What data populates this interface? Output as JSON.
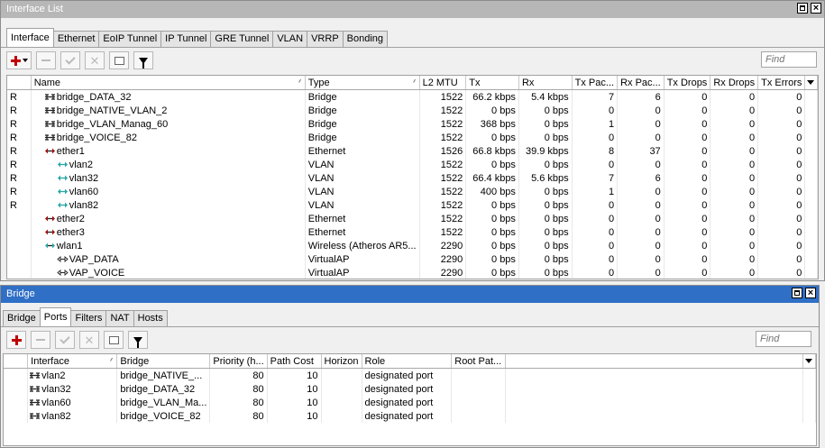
{
  "interface_window": {
    "title": "Interface List",
    "tabs": [
      "Interface",
      "Ethernet",
      "EoIP Tunnel",
      "IP Tunnel",
      "GRE Tunnel",
      "VLAN",
      "VRRP",
      "Bonding"
    ],
    "find_placeholder": "Find",
    "columns": [
      "",
      "Name",
      "Type",
      "L2 MTU",
      "Tx",
      "Rx",
      "Tx Pac...",
      "Rx Pac...",
      "Tx Drops",
      "Rx Drops",
      "Tx Errors"
    ],
    "rows": [
      {
        "flag": "R",
        "icon": "bridge-icon",
        "indent": 1,
        "name": "bridge_DATA_32",
        "type": "Bridge",
        "l2mtu": "1522",
        "tx": "66.2 kbps",
        "rx": "5.4 kbps",
        "txp": "7",
        "rxp": "6",
        "txd": "0",
        "rxd": "0",
        "txe": "0"
      },
      {
        "flag": "R",
        "icon": "bridge-icon",
        "indent": 1,
        "name": "bridge_NATIVE_VLAN_2",
        "type": "Bridge",
        "l2mtu": "1522",
        "tx": "0 bps",
        "rx": "0 bps",
        "txp": "0",
        "rxp": "0",
        "txd": "0",
        "rxd": "0",
        "txe": "0"
      },
      {
        "flag": "R",
        "icon": "bridge-icon",
        "indent": 1,
        "name": "bridge_VLAN_Manag_60",
        "type": "Bridge",
        "l2mtu": "1522",
        "tx": "368 bps",
        "rx": "0 bps",
        "txp": "1",
        "rxp": "0",
        "txd": "0",
        "rxd": "0",
        "txe": "0"
      },
      {
        "flag": "R",
        "icon": "bridge-icon",
        "indent": 1,
        "name": "bridge_VOICE_82",
        "type": "Bridge",
        "l2mtu": "1522",
        "tx": "0 bps",
        "rx": "0 bps",
        "txp": "0",
        "rxp": "0",
        "txd": "0",
        "rxd": "0",
        "txe": "0"
      },
      {
        "flag": "R",
        "icon": "ethernet-icon",
        "indent": 1,
        "name": "ether1",
        "type": "Ethernet",
        "l2mtu": "1526",
        "tx": "66.8 kbps",
        "rx": "39.9 kbps",
        "txp": "8",
        "rxp": "37",
        "txd": "0",
        "rxd": "0",
        "txe": "0"
      },
      {
        "flag": "R",
        "icon": "vlan-icon",
        "indent": 2,
        "name": "vlan2",
        "type": "VLAN",
        "l2mtu": "1522",
        "tx": "0 bps",
        "rx": "0 bps",
        "txp": "0",
        "rxp": "0",
        "txd": "0",
        "rxd": "0",
        "txe": "0"
      },
      {
        "flag": "R",
        "icon": "vlan-icon",
        "indent": 2,
        "name": "vlan32",
        "type": "VLAN",
        "l2mtu": "1522",
        "tx": "66.4 kbps",
        "rx": "5.6 kbps",
        "txp": "7",
        "rxp": "6",
        "txd": "0",
        "rxd": "0",
        "txe": "0"
      },
      {
        "flag": "R",
        "icon": "vlan-icon",
        "indent": 2,
        "name": "vlan60",
        "type": "VLAN",
        "l2mtu": "1522",
        "tx": "400 bps",
        "rx": "0 bps",
        "txp": "1",
        "rxp": "0",
        "txd": "0",
        "rxd": "0",
        "txe": "0"
      },
      {
        "flag": "R",
        "icon": "vlan-icon",
        "indent": 2,
        "name": "vlan82",
        "type": "VLAN",
        "l2mtu": "1522",
        "tx": "0 bps",
        "rx": "0 bps",
        "txp": "0",
        "rxp": "0",
        "txd": "0",
        "rxd": "0",
        "txe": "0"
      },
      {
        "flag": "",
        "icon": "ethernet-icon",
        "indent": 1,
        "name": "ether2",
        "type": "Ethernet",
        "l2mtu": "1522",
        "tx": "0 bps",
        "rx": "0 bps",
        "txp": "0",
        "rxp": "0",
        "txd": "0",
        "rxd": "0",
        "txe": "0"
      },
      {
        "flag": "",
        "icon": "ethernet-icon",
        "indent": 1,
        "name": "ether3",
        "type": "Ethernet",
        "l2mtu": "1522",
        "tx": "0 bps",
        "rx": "0 bps",
        "txp": "0",
        "rxp": "0",
        "txd": "0",
        "rxd": "0",
        "txe": "0"
      },
      {
        "flag": "",
        "icon": "wireless-icon",
        "indent": 1,
        "name": "wlan1",
        "type": "Wireless (Atheros AR5...",
        "l2mtu": "2290",
        "tx": "0 bps",
        "rx": "0 bps",
        "txp": "0",
        "rxp": "0",
        "txd": "0",
        "rxd": "0",
        "txe": "0"
      },
      {
        "flag": "",
        "icon": "virtualap-icon",
        "indent": 2,
        "name": "VAP_DATA",
        "type": "VirtualAP",
        "l2mtu": "2290",
        "tx": "0 bps",
        "rx": "0 bps",
        "txp": "0",
        "rxp": "0",
        "txd": "0",
        "rxd": "0",
        "txe": "0"
      },
      {
        "flag": "",
        "icon": "virtualap-icon",
        "indent": 2,
        "name": "VAP_VOICE",
        "type": "VirtualAP",
        "l2mtu": "2290",
        "tx": "0 bps",
        "rx": "0 bps",
        "txp": "0",
        "rxp": "0",
        "txd": "0",
        "rxd": "0",
        "txe": "0"
      }
    ]
  },
  "bridge_window": {
    "title": "Bridge",
    "tabs": [
      "Bridge",
      "Ports",
      "Filters",
      "NAT",
      "Hosts"
    ],
    "find_placeholder": "Find",
    "columns": [
      "Interface",
      "Bridge",
      "Priority (h...",
      "Path Cost",
      "Horizon",
      "Role",
      "Root Pat..."
    ],
    "rows": [
      {
        "interface": "vlan2",
        "bridge": "bridge_NATIVE_...",
        "priority": "80",
        "path_cost": "10",
        "horizon": "",
        "role": "designated port",
        "root_path": ""
      },
      {
        "interface": "vlan32",
        "bridge": "bridge_DATA_32",
        "priority": "80",
        "path_cost": "10",
        "horizon": "",
        "role": "designated port",
        "root_path": ""
      },
      {
        "interface": "vlan60",
        "bridge": "bridge_VLAN_Ma...",
        "priority": "80",
        "path_cost": "10",
        "horizon": "",
        "role": "designated port",
        "root_path": ""
      },
      {
        "interface": "vlan82",
        "bridge": "bridge_VOICE_82",
        "priority": "80",
        "path_cost": "10",
        "horizon": "",
        "role": "designated port",
        "root_path": ""
      }
    ]
  },
  "colors": {
    "active_title": "#2f6fc6",
    "inactive_title": "#b7b7b7",
    "add_red": "#c00000",
    "icon_dark": "#202020",
    "vlan_teal": "#2aa7a7",
    "eth_red": "#a01010"
  }
}
